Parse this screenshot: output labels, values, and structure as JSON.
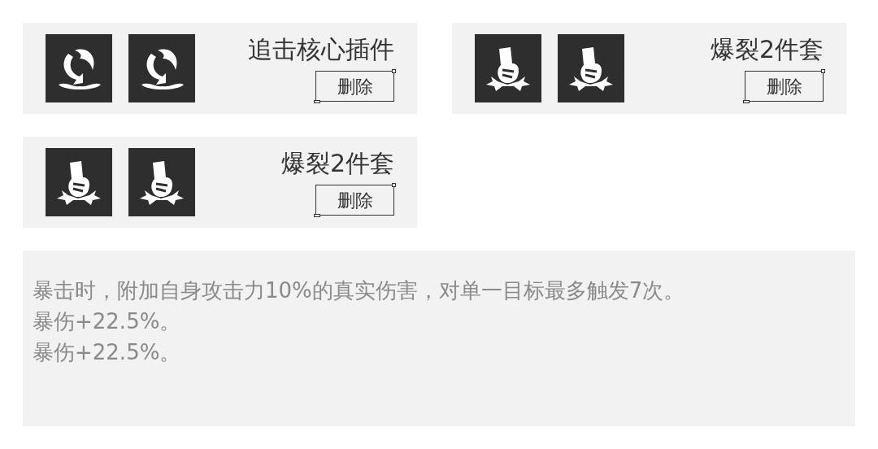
{
  "cards": [
    {
      "icons": [
        {
          "kind": "chase"
        },
        {
          "kind": "chase"
        }
      ],
      "title": "追击核心插件",
      "button": "删除"
    },
    {
      "icons": [
        {
          "kind": "burst"
        },
        {
          "kind": "burst"
        }
      ],
      "title": "爆裂2件套",
      "button": "删除"
    },
    {
      "icons": [
        {
          "kind": "burst"
        },
        {
          "kind": "burst"
        }
      ],
      "title": "爆裂2件套",
      "button": "删除"
    }
  ],
  "description": [
    "暴击时，附加自身攻击力10%的真实伤害，对单一目标最多触发7次。",
    "暴伤+22.5%。",
    "暴伤+22.5%。"
  ]
}
